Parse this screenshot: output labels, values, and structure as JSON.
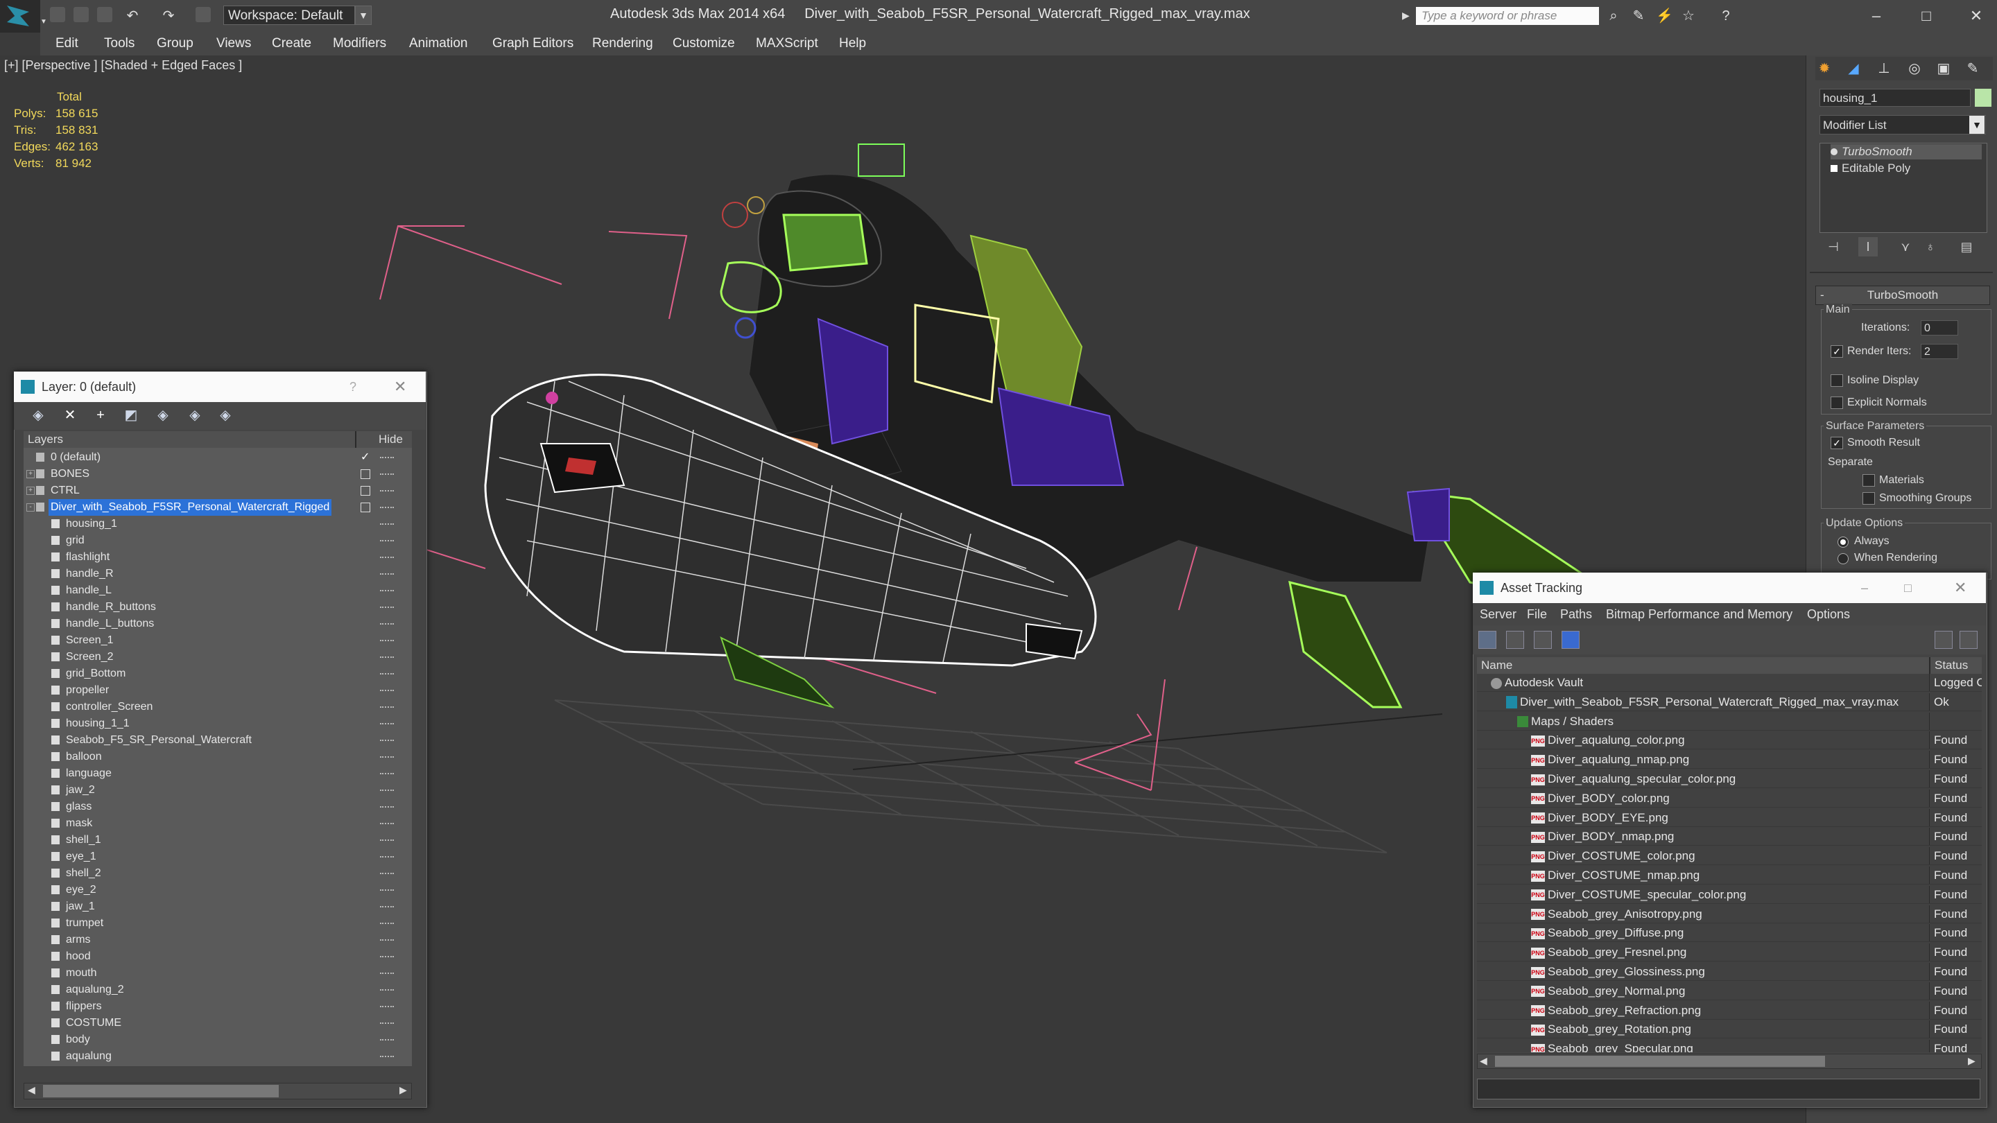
{
  "app": {
    "title": "Autodesk 3ds Max 2014 x64",
    "file": "Diver_with_Seabob_F5SR_Personal_Watercraft_Rigged_max_vray.max",
    "workspace": "Workspace: Default",
    "search_placeholder": "Type a keyword or phrase"
  },
  "menu": [
    "Edit",
    "Tools",
    "Group",
    "Views",
    "Create",
    "Modifiers",
    "Animation",
    "Graph Editors",
    "Rendering",
    "Customize",
    "MAXScript",
    "Help"
  ],
  "viewport": {
    "label": "[+] [Perspective ] [Shaded + Edged Faces ]",
    "stats": {
      "header": "Total",
      "rows": [
        {
          "k": "Polys:",
          "v": "158 615"
        },
        {
          "k": "Tris:",
          "v": "158 831"
        },
        {
          "k": "Edges:",
          "v": "462 163"
        },
        {
          "k": "Verts:",
          "v": "81 942"
        }
      ]
    }
  },
  "command_panel": {
    "object_name": "housing_1",
    "modifier_list": "Modifier List",
    "stack": [
      "TurboSmooth",
      "Editable Poly"
    ],
    "rollout": "TurboSmooth",
    "main_group": "Main",
    "iterations_label": "Iterations:",
    "iterations_value": "0",
    "render_iters_label": "Render Iters:",
    "render_iters_value": "2",
    "isoline": "Isoline Display",
    "explicit": "Explicit Normals",
    "surface_group": "Surface Parameters",
    "smooth_result": "Smooth Result",
    "separate": "Separate",
    "materials": "Materials",
    "smoothing_groups": "Smoothing Groups",
    "update_group": "Update Options",
    "always": "Always",
    "when_rendering": "When Rendering"
  },
  "layers": {
    "title": "Layer: 0 (default)",
    "col_layers": "Layers",
    "col_hide": "Hide",
    "rows": [
      {
        "name": "0 (default)",
        "level": 0,
        "check": true
      },
      {
        "name": "BONES",
        "level": 0,
        "expand": true
      },
      {
        "name": "CTRL",
        "level": 0,
        "expand": true
      },
      {
        "name": "Diver_with_Seabob_F5SR_Personal_Watercraft_Rigged",
        "level": 0,
        "selected": true
      },
      {
        "name": "housing_1",
        "level": 1
      },
      {
        "name": "grid",
        "level": 1
      },
      {
        "name": "flashlight",
        "level": 1
      },
      {
        "name": "handle_R",
        "level": 1
      },
      {
        "name": "handle_L",
        "level": 1
      },
      {
        "name": "handle_R_buttons",
        "level": 1
      },
      {
        "name": "handle_L_buttons",
        "level": 1
      },
      {
        "name": "Screen_1",
        "level": 1
      },
      {
        "name": "Screen_2",
        "level": 1
      },
      {
        "name": "grid_Bottom",
        "level": 1
      },
      {
        "name": "propeller",
        "level": 1
      },
      {
        "name": "controller_Screen",
        "level": 1
      },
      {
        "name": "housing_1_1",
        "level": 1
      },
      {
        "name": "Seabob_F5_SR_Personal_Watercraft",
        "level": 1
      },
      {
        "name": "balloon",
        "level": 1
      },
      {
        "name": "language",
        "level": 1
      },
      {
        "name": "jaw_2",
        "level": 1
      },
      {
        "name": "glass",
        "level": 1
      },
      {
        "name": "mask",
        "level": 1
      },
      {
        "name": "shell_1",
        "level": 1
      },
      {
        "name": "eye_1",
        "level": 1
      },
      {
        "name": "shell_2",
        "level": 1
      },
      {
        "name": "eye_2",
        "level": 1
      },
      {
        "name": "jaw_1",
        "level": 1
      },
      {
        "name": "trumpet",
        "level": 1
      },
      {
        "name": "arms",
        "level": 1
      },
      {
        "name": "hood",
        "level": 1
      },
      {
        "name": "mouth",
        "level": 1
      },
      {
        "name": "aqualung_2",
        "level": 1
      },
      {
        "name": "flippers",
        "level": 1
      },
      {
        "name": "COSTUME",
        "level": 1
      },
      {
        "name": "body",
        "level": 1
      },
      {
        "name": "aqualung",
        "level": 1
      }
    ]
  },
  "asset_tracking": {
    "title": "Asset Tracking",
    "menu": [
      "Server",
      "File",
      "Paths",
      "Bitmap Performance and Memory",
      "Options"
    ],
    "col_name": "Name",
    "col_status": "Status",
    "rows": [
      {
        "name": "Autodesk Vault",
        "level": 0,
        "status": "Logged O"
      },
      {
        "name": "Diver_with_Seabob_F5SR_Personal_Watercraft_Rigged_max_vray.max",
        "level": 1,
        "status": "Ok"
      },
      {
        "name": "Maps / Shaders",
        "level": 2,
        "status": ""
      },
      {
        "name": "Diver_aqualung_color.png",
        "level": 3,
        "status": "Found"
      },
      {
        "name": "Diver_aqualung_nmap.png",
        "level": 3,
        "status": "Found"
      },
      {
        "name": "Diver_aqualung_specular_color.png",
        "level": 3,
        "status": "Found"
      },
      {
        "name": "Diver_BODY_color.png",
        "level": 3,
        "status": "Found"
      },
      {
        "name": "Diver_BODY_EYE.png",
        "level": 3,
        "status": "Found"
      },
      {
        "name": "Diver_BODY_nmap.png",
        "level": 3,
        "status": "Found"
      },
      {
        "name": "Diver_COSTUME_color.png",
        "level": 3,
        "status": "Found"
      },
      {
        "name": "Diver_COSTUME_nmap.png",
        "level": 3,
        "status": "Found"
      },
      {
        "name": "Diver_COSTUME_specular_color.png",
        "level": 3,
        "status": "Found"
      },
      {
        "name": "Seabob_grey_Anisotropy.png",
        "level": 3,
        "status": "Found"
      },
      {
        "name": "Seabob_grey_Diffuse.png",
        "level": 3,
        "status": "Found"
      },
      {
        "name": "Seabob_grey_Fresnel.png",
        "level": 3,
        "status": "Found"
      },
      {
        "name": "Seabob_grey_Glossiness.png",
        "level": 3,
        "status": "Found"
      },
      {
        "name": "Seabob_grey_Normal.png",
        "level": 3,
        "status": "Found"
      },
      {
        "name": "Seabob_grey_Refraction.png",
        "level": 3,
        "status": "Found"
      },
      {
        "name": "Seabob_grey_Rotation.png",
        "level": 3,
        "status": "Found"
      },
      {
        "name": "Seabob_grey_Specular.png",
        "level": 3,
        "status": "Found"
      }
    ]
  },
  "colors": {
    "selection": "#2c72d8",
    "stats_text": "#f2d95b",
    "wire_green": "#8cf04a",
    "wire_white": "#ffffff",
    "helper_pink": "#e0608a",
    "object_color": "#b9e5a8"
  }
}
